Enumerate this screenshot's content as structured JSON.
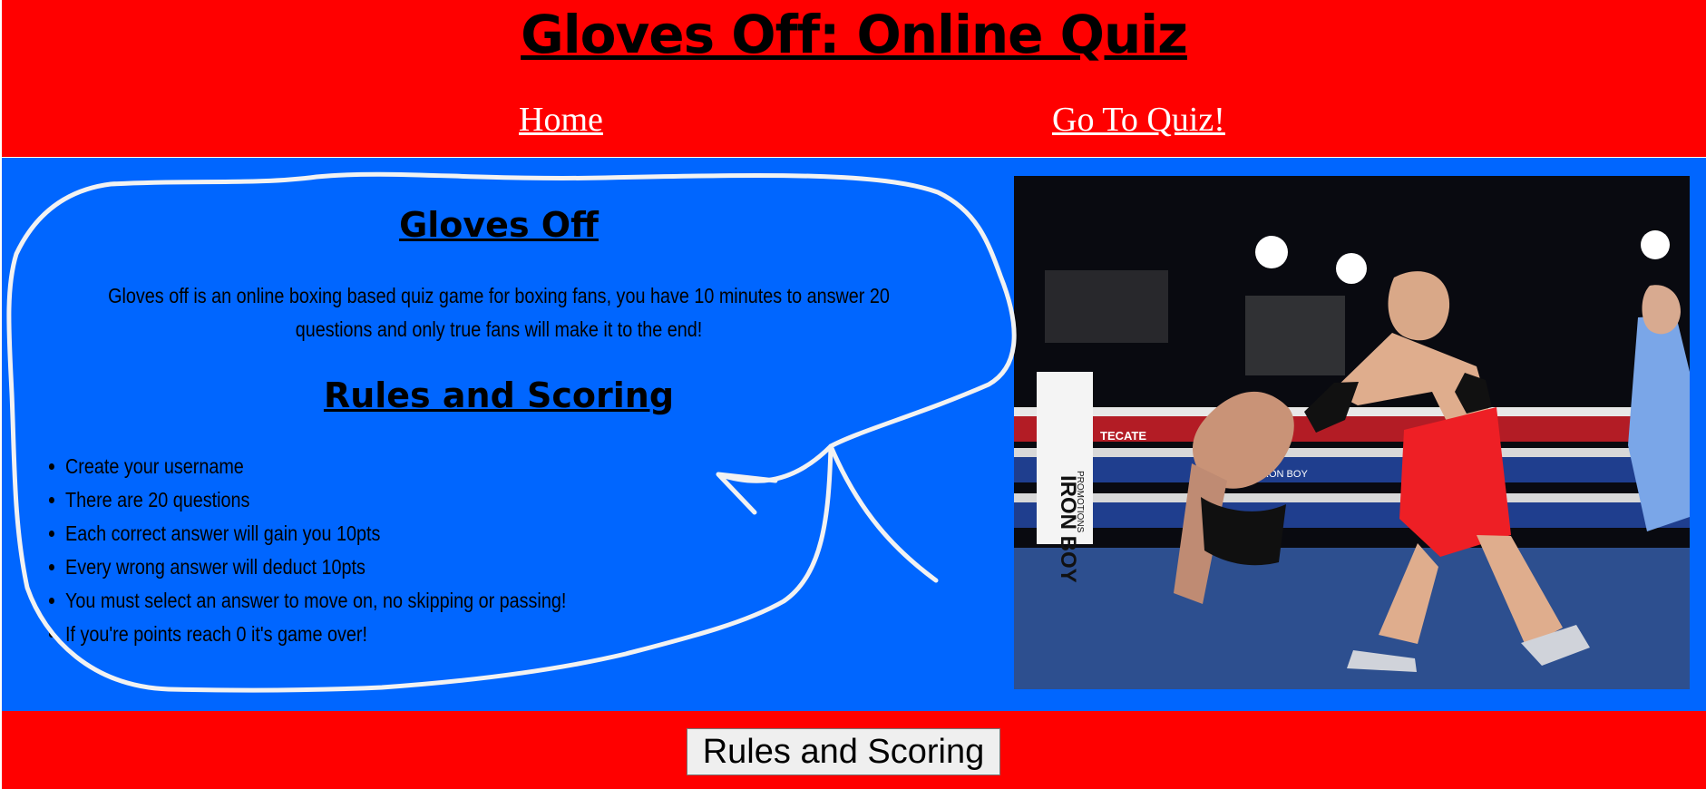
{
  "header": {
    "title": "Gloves Off: Online Quiz",
    "nav": {
      "home": "Home",
      "quiz": "Go To Quiz!"
    }
  },
  "main": {
    "section_title": "Gloves Off",
    "intro": "Gloves off is an online boxing based quiz game for boxing fans, you have 10 minutes to answer 20 questions and only true fans will make it to the end!",
    "rules_title": "Rules and Scoring",
    "rules": [
      "Create your username",
      "There are 20 questions",
      "Each correct answer will gain you 10pts",
      "Every wrong answer will deduct 10pts",
      "You must select an answer to move on, no skipping or passing!",
      "If you're points reach 0 it's game over!"
    ],
    "image": {
      "banner_1": "IRON BOY",
      "banner_2": "PROMOTIONS",
      "sign_1": "TECATE",
      "sign_2": "IRON BOY"
    }
  },
  "footer": {
    "button": "Rules and Scoring"
  },
  "colors": {
    "header_bg": "#ff0000",
    "main_bg": "#0066ff",
    "link": "#ffffff"
  }
}
